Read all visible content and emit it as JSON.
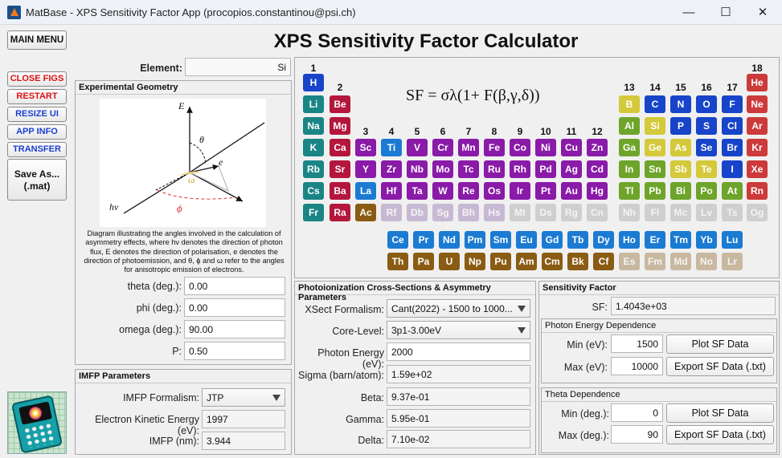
{
  "window": {
    "title": "MatBase - XPS Sensitivity Factor App (procopios.constantinou@psi.ch)",
    "minimize": "—",
    "maximize": "☐",
    "close": "✕"
  },
  "app": {
    "title": "XPS Sensitivity Factor Calculator"
  },
  "sidebar": {
    "main_menu": "MAIN MENU",
    "close_figs": "CLOSE FIGS",
    "restart": "RESTART",
    "resize_ui": "RESIZE UI",
    "app_info": "APP INFO",
    "transfer": "TRANSFER",
    "save_as_1": "Save As...",
    "save_as_2": "(.mat)"
  },
  "element": {
    "label": "Element:",
    "value": "Si"
  },
  "geometry": {
    "title": "Experimental Geometry",
    "diagram": {
      "E": "E",
      "theta": "θ",
      "e": "e",
      "omega": "ω",
      "hv": "hν",
      "phi": "ϕ"
    },
    "caption": "Diagram illustrating the angles involved in the calculation of asymmetry effects, where hν denotes the direction of photon flux, E denotes the direction of polarisation, e denotes the direction of photoemission, and θ, ϕ and ω refer to the angles for anisotropic emission of electrons.",
    "theta_label": "theta (deg.):",
    "theta": "0.00",
    "phi_label": "phi (deg.):",
    "phi": "0.00",
    "omega_label": "omega (deg.):",
    "omega": "90.00",
    "p_label": "P:",
    "p": "0.50"
  },
  "imfp": {
    "title": "IMFP Parameters",
    "formalism_label": "IMFP Formalism:",
    "formalism": "JTP",
    "ke_label": "Electron Kinetic Energy (eV):",
    "ke": "1997",
    "imfp_label": "IMFP (nm):",
    "imfp": "3.944"
  },
  "cross": {
    "title": "Photoionization Cross-Sections & Asymmetry Parameters",
    "xsect_label": "XSect Formalism:",
    "xsect": "Cant(2022) - 1500 to 1000...",
    "core_label": "Core-Level:",
    "core": "3p1-3.00eV",
    "pe_label": "Photon Energy (eV):",
    "pe": "2000",
    "sigma_label": "Sigma (barn/atom):",
    "sigma": "1.59e+02",
    "beta_label": "Beta:",
    "beta": "9.37e-01",
    "gamma_label": "Gamma:",
    "gamma": "5.95e-01",
    "delta_label": "Delta:",
    "delta": "7.10e-02"
  },
  "sf": {
    "title": "Sensitivity Factor",
    "sf_label": "SF:",
    "sf": "1.4043e+03",
    "photon_title": "Photon Energy Dependence",
    "min_ev_label": "Min (eV):",
    "min_ev": "1500",
    "max_ev_label": "Max (eV):",
    "max_ev": "10000",
    "plot1": "Plot SF Data",
    "export1": "Export SF Data (.txt)",
    "theta_title": "Theta Dependence",
    "min_deg_label": "Min (deg.):",
    "min_deg": "0",
    "max_deg_label": "Max (deg.):",
    "max_deg": "90",
    "plot2": "Plot SF Data",
    "export2": "Export SF Data (.txt)"
  },
  "formula": "SF = σλ(1+ F(β,γ,δ))",
  "groups": [
    "1",
    "2",
    "3",
    "4",
    "5",
    "6",
    "7",
    "8",
    "9",
    "10",
    "11",
    "12",
    "13",
    "14",
    "15",
    "16",
    "17",
    "18"
  ],
  "colors": {
    "alkali": "#1a8585",
    "alkaline": "#b4163c",
    "transition": "#8a1aa8",
    "lanthanide": "#1b7bd2",
    "actinide": "#8a5c13",
    "posttrans": "#6ea42a",
    "metalloid": "#a5b322",
    "nonmetal": "#1744c9",
    "noble": "#cc3a3a",
    "superheavy": "#c7b9d4",
    "unknown": "#cfcfcf",
    "ln_fade": "#c9b8a0",
    "yellow": "#d4c93a",
    "hydrogen": "#1744c9",
    "ti": "#1b7bd2",
    "fe": "#8a1aa8"
  },
  "elements": [
    [
      "H",
      1,
      1,
      "nonmetal"
    ],
    [
      "He",
      18,
      1,
      "noble"
    ],
    [
      "Li",
      1,
      2,
      "alkali"
    ],
    [
      "Be",
      2,
      2,
      "alkaline"
    ],
    [
      "B",
      13,
      2,
      "metalloid"
    ],
    [
      "C",
      14,
      2,
      "nonmetal"
    ],
    [
      "N",
      15,
      2,
      "nonmetal"
    ],
    [
      "O",
      16,
      2,
      "nonmetal"
    ],
    [
      "F",
      17,
      2,
      "nonmetal"
    ],
    [
      "Ne",
      18,
      2,
      "noble"
    ],
    [
      "Na",
      1,
      3,
      "alkali"
    ],
    [
      "Mg",
      2,
      3,
      "alkaline"
    ],
    [
      "Al",
      13,
      3,
      "posttrans"
    ],
    [
      "Si",
      14,
      3,
      "metalloid"
    ],
    [
      "P",
      15,
      3,
      "nonmetal"
    ],
    [
      "S",
      16,
      3,
      "nonmetal"
    ],
    [
      "Cl",
      17,
      3,
      "nonmetal"
    ],
    [
      "Ar",
      18,
      3,
      "noble"
    ],
    [
      "K",
      1,
      4,
      "alkali"
    ],
    [
      "Ca",
      2,
      4,
      "alkaline"
    ],
    [
      "Sc",
      3,
      4,
      "transition"
    ],
    [
      "Ti",
      4,
      4,
      "transition"
    ],
    [
      "V",
      5,
      4,
      "transition"
    ],
    [
      "Cr",
      6,
      4,
      "transition"
    ],
    [
      "Mn",
      7,
      4,
      "transition"
    ],
    [
      "Fe",
      8,
      4,
      "transition"
    ],
    [
      "Co",
      9,
      4,
      "transition"
    ],
    [
      "Ni",
      10,
      4,
      "transition"
    ],
    [
      "Cu",
      11,
      4,
      "transition"
    ],
    [
      "Zn",
      12,
      4,
      "transition"
    ],
    [
      "Ga",
      13,
      4,
      "posttrans"
    ],
    [
      "Ge",
      14,
      4,
      "metalloid"
    ],
    [
      "As",
      15,
      4,
      "metalloid"
    ],
    [
      "Se",
      16,
      4,
      "nonmetal"
    ],
    [
      "Br",
      17,
      4,
      "nonmetal"
    ],
    [
      "Kr",
      18,
      4,
      "noble"
    ],
    [
      "Rb",
      1,
      5,
      "alkali"
    ],
    [
      "Sr",
      2,
      5,
      "alkaline"
    ],
    [
      "Y",
      3,
      5,
      "transition"
    ],
    [
      "Zr",
      4,
      5,
      "transition"
    ],
    [
      "Nb",
      5,
      5,
      "transition"
    ],
    [
      "Mo",
      6,
      5,
      "transition"
    ],
    [
      "Tc",
      7,
      5,
      "transition"
    ],
    [
      "Ru",
      8,
      5,
      "transition"
    ],
    [
      "Rh",
      9,
      5,
      "transition"
    ],
    [
      "Pd",
      10,
      5,
      "transition"
    ],
    [
      "Ag",
      11,
      5,
      "transition"
    ],
    [
      "Cd",
      12,
      5,
      "transition"
    ],
    [
      "In",
      13,
      5,
      "posttrans"
    ],
    [
      "Sn",
      14,
      5,
      "posttrans"
    ],
    [
      "Sb",
      15,
      5,
      "metalloid"
    ],
    [
      "Te",
      16,
      5,
      "metalloid"
    ],
    [
      "I",
      17,
      5,
      "nonmetal"
    ],
    [
      "Xe",
      18,
      5,
      "noble"
    ],
    [
      "Cs",
      1,
      6,
      "alkali"
    ],
    [
      "Ba",
      2,
      6,
      "alkaline"
    ],
    [
      "La",
      3,
      6,
      "lanthanide"
    ],
    [
      "Hf",
      4,
      6,
      "transition"
    ],
    [
      "Ta",
      5,
      6,
      "transition"
    ],
    [
      "W",
      6,
      6,
      "transition"
    ],
    [
      "Re",
      7,
      6,
      "transition"
    ],
    [
      "Os",
      8,
      6,
      "transition"
    ],
    [
      "Ir",
      9,
      6,
      "transition"
    ],
    [
      "Pt",
      10,
      6,
      "transition"
    ],
    [
      "Au",
      11,
      6,
      "transition"
    ],
    [
      "Hg",
      12,
      6,
      "transition"
    ],
    [
      "Tl",
      13,
      6,
      "posttrans"
    ],
    [
      "Pb",
      14,
      6,
      "posttrans"
    ],
    [
      "Bi",
      15,
      6,
      "posttrans"
    ],
    [
      "Po",
      16,
      6,
      "posttrans"
    ],
    [
      "At",
      17,
      6,
      "posttrans"
    ],
    [
      "Rn",
      18,
      6,
      "noble"
    ],
    [
      "Fr",
      1,
      7,
      "alkali"
    ],
    [
      "Ra",
      2,
      7,
      "alkaline"
    ],
    [
      "Ac",
      3,
      7,
      "actinide"
    ],
    [
      "Rf",
      4,
      7,
      "superheavy"
    ],
    [
      "Db",
      5,
      7,
      "superheavy"
    ],
    [
      "Sg",
      6,
      7,
      "superheavy"
    ],
    [
      "Bh",
      7,
      7,
      "superheavy"
    ],
    [
      "Hs",
      8,
      7,
      "superheavy"
    ],
    [
      "Mt",
      9,
      7,
      "unknown"
    ],
    [
      "Ds",
      10,
      7,
      "unknown"
    ],
    [
      "Rg",
      11,
      7,
      "unknown"
    ],
    [
      "Cn",
      12,
      7,
      "unknown"
    ],
    [
      "Nh",
      13,
      7,
      "unknown"
    ],
    [
      "Fl",
      14,
      7,
      "unknown"
    ],
    [
      "Mc",
      15,
      7,
      "unknown"
    ],
    [
      "Lv",
      16,
      7,
      "unknown"
    ],
    [
      "Ts",
      17,
      7,
      "unknown"
    ],
    [
      "Og",
      18,
      7,
      "unknown"
    ],
    [
      "Ce",
      4,
      9,
      "lanthanide"
    ],
    [
      "Pr",
      5,
      9,
      "lanthanide"
    ],
    [
      "Nd",
      6,
      9,
      "lanthanide"
    ],
    [
      "Pm",
      7,
      9,
      "lanthanide"
    ],
    [
      "Sm",
      8,
      9,
      "lanthanide"
    ],
    [
      "Eu",
      9,
      9,
      "lanthanide"
    ],
    [
      "Gd",
      10,
      9,
      "lanthanide"
    ],
    [
      "Tb",
      11,
      9,
      "lanthanide"
    ],
    [
      "Dy",
      12,
      9,
      "lanthanide"
    ],
    [
      "Ho",
      13,
      9,
      "lanthanide"
    ],
    [
      "Er",
      14,
      9,
      "lanthanide"
    ],
    [
      "Tm",
      15,
      9,
      "lanthanide"
    ],
    [
      "Yb",
      16,
      9,
      "lanthanide"
    ],
    [
      "Lu",
      17,
      9,
      "lanthanide"
    ],
    [
      "Th",
      4,
      10,
      "actinide"
    ],
    [
      "Pa",
      5,
      10,
      "actinide"
    ],
    [
      "U",
      6,
      10,
      "actinide"
    ],
    [
      "Np",
      7,
      10,
      "actinide"
    ],
    [
      "Pu",
      8,
      10,
      "actinide"
    ],
    [
      "Am",
      9,
      10,
      "actinide"
    ],
    [
      "Cm",
      10,
      10,
      "actinide"
    ],
    [
      "Bk",
      11,
      10,
      "actinide"
    ],
    [
      "Cf",
      12,
      10,
      "actinide"
    ],
    [
      "Es",
      13,
      10,
      "ln_fade"
    ],
    [
      "Fm",
      14,
      10,
      "ln_fade"
    ],
    [
      "Md",
      15,
      10,
      "ln_fade"
    ],
    [
      "No",
      16,
      10,
      "ln_fade"
    ],
    [
      "Lr",
      17,
      10,
      "ln_fade"
    ]
  ]
}
